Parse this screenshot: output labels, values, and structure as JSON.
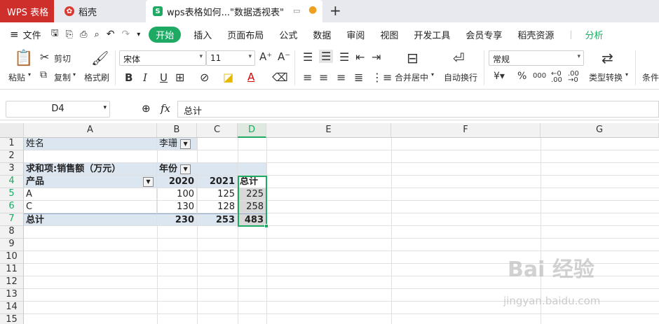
{
  "tabs": {
    "wps": "WPS 表格",
    "daoke": "稻壳",
    "doc": "wps表格如何...\"数据透视表\"",
    "new_tab": "+"
  },
  "menu": {
    "file": "文件",
    "items": [
      "开始",
      "插入",
      "页面布局",
      "公式",
      "数据",
      "审阅",
      "视图",
      "开发工具",
      "会员专享",
      "稻壳资源"
    ],
    "analyze": "分析"
  },
  "ribbon": {
    "paste": "粘贴",
    "cut": "剪切",
    "copy": "复制",
    "format_painter": "格式刷",
    "font_name": "宋体",
    "font_size": "11",
    "merge_center": "合并居中",
    "wrap_text": "自动换行",
    "number_format": "常规",
    "type_convert": "类型转换",
    "conditional": "条件"
  },
  "formula_bar": {
    "name_box": "D4",
    "fx": "fx",
    "content": "总计"
  },
  "columns": [
    "A",
    "B",
    "C",
    "D",
    "E",
    "F",
    "G"
  ],
  "rows": [
    "1",
    "2",
    "3",
    "4",
    "5",
    "6",
    "7",
    "8",
    "9",
    "10",
    "11",
    "12",
    "13",
    "14",
    "15"
  ],
  "sheet": {
    "r1": {
      "a": "姓名",
      "b": "李珊"
    },
    "r3": {
      "a": "求和项:销售额（万元）",
      "b": "年份"
    },
    "r4": {
      "a": "产品",
      "b": "2020",
      "c": "2021",
      "d": "总计"
    },
    "r5": {
      "a": "A",
      "b": "100",
      "c": "125",
      "d": "225"
    },
    "r6": {
      "a": "C",
      "b": "130",
      "c": "128",
      "d": "258"
    },
    "r7": {
      "a": "总计",
      "b": "230",
      "c": "253",
      "d": "483"
    }
  },
  "watermark": {
    "logo": "Bai 经验",
    "url": "jingyan.baidu.com"
  },
  "colors": {
    "wps_red": "#cf2f2b",
    "accent_green": "#1eaa63",
    "pivot_header_blue": "#dce6f1"
  }
}
